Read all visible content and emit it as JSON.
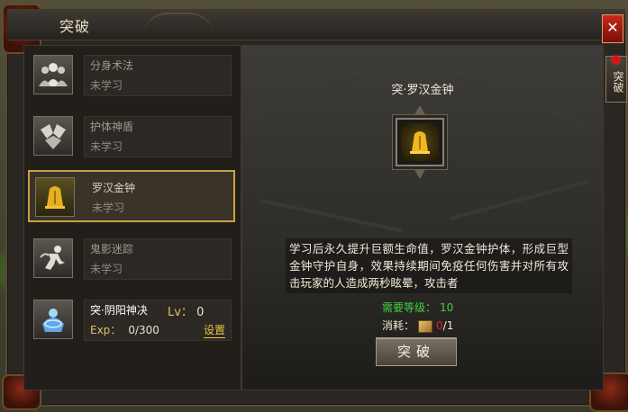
{
  "window": {
    "title": "突破",
    "close_label": "✕",
    "side_tab_label": "突破"
  },
  "skills": [
    {
      "name": "分身术法",
      "state": "未学习",
      "icon": "crowd-silhouette-icon"
    },
    {
      "name": "护体神盾",
      "state": "未学习",
      "icon": "shield-pieces-icon"
    },
    {
      "name": "罗汉金钟",
      "state": "未学习",
      "icon": "golden-bell-icon"
    },
    {
      "name": "鬼影迷踪",
      "state": "未学习",
      "icon": "shadow-runner-icon"
    }
  ],
  "special_skill": {
    "name": "突·阴阳神决",
    "lv_label": "Lv：",
    "lv_value": "0",
    "exp_label": "Exp：",
    "exp_value": "0/300",
    "settings_label": "设置",
    "icon": "yinyang-armor-icon"
  },
  "detail": {
    "title": "突·罗汉金钟",
    "icon": "golden-bell-icon",
    "description": "学习后永久提升巨额生命值，罗汉金钟护体，形成巨型金钟守护自身，效果持续期间免疫任何伤害并对所有攻击玩家的人造成两秒眩晕，攻击者",
    "requirement_label": "需要等级：",
    "requirement_value": "10",
    "cost_label": "消耗：",
    "cost_have": "0",
    "cost_need": "/1",
    "break_button": "突破"
  },
  "colors": {
    "accent_gold": "#c8a040",
    "req_green": "#40d040",
    "cost_red": "#e02020"
  }
}
